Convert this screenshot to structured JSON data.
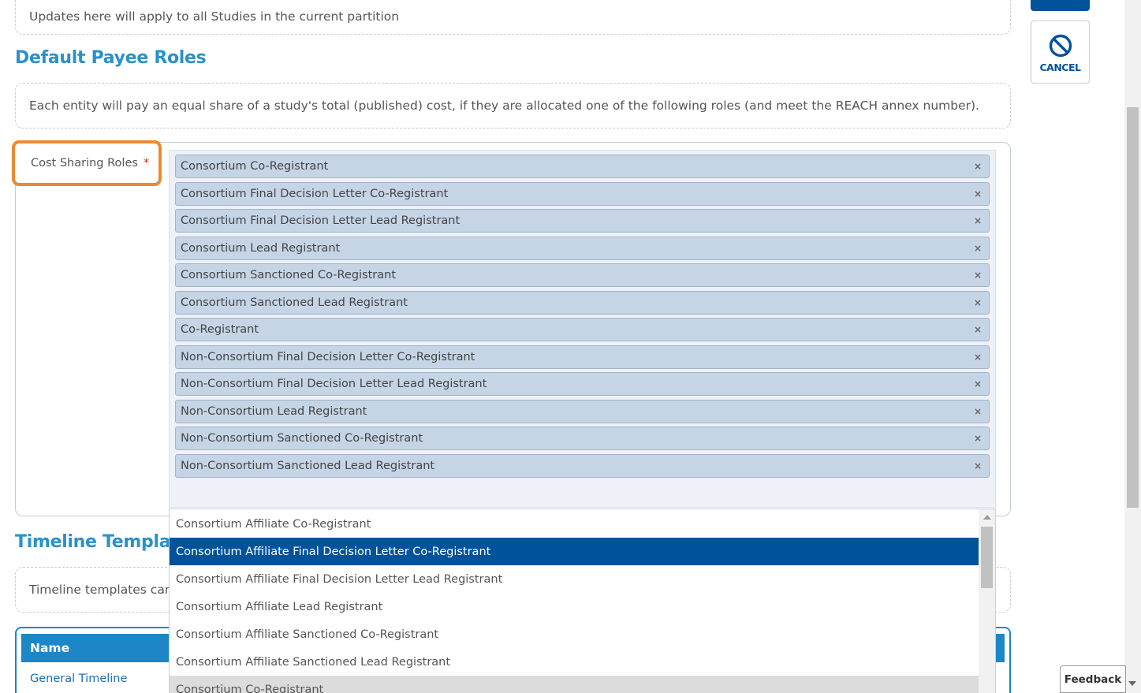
{
  "top_info": {
    "text": "Updates here will apply to all Studies in the current partition"
  },
  "payee": {
    "title": "Default Payee Roles",
    "description": "Each entity will pay an equal share of a study's total (published) cost, if they are allocated one of the following roles (and meet the REACH annex number)."
  },
  "field": {
    "label": "Cost Sharing Roles",
    "required_marker": "*"
  },
  "selected_roles": [
    "Consortium Co-Registrant",
    "Consortium Final Decision Letter Co-Registrant",
    "Consortium Final Decision Letter Lead Registrant",
    "Consortium Lead Registrant",
    "Consortium Sanctioned Co-Registrant",
    "Consortium Sanctioned Lead Registrant",
    "Co-Registrant",
    "Non-Consortium Final Decision Letter Co-Registrant",
    "Non-Consortium Final Decision Letter Lead Registrant",
    "Non-Consortium Lead Registrant",
    "Non-Consortium Sanctioned Co-Registrant",
    "Non-Consortium Sanctioned Lead Registrant"
  ],
  "remove_symbol": "×",
  "dropdown_options": [
    "Consortium Affiliate Co-Registrant",
    "Consortium Affiliate Final Decision Letter Co-Registrant",
    "Consortium Affiliate Final Decision Letter Lead Registrant",
    "Consortium Affiliate Lead Registrant",
    "Consortium Affiliate Sanctioned Co-Registrant",
    "Consortium Affiliate Sanctioned Lead Registrant",
    "Consortium Co-Registrant"
  ],
  "highlighted_option_index": 1,
  "timeline": {
    "title": "Timeline Templates",
    "description": "Timeline templates can",
    "table_header_name": "Name",
    "first_row_name": "General Timeline"
  },
  "actions": {
    "cancel_label": "CANCEL"
  },
  "feedback_label": "Feedback",
  "colors": {
    "accent": "#2a91c9",
    "primary_button": "#00539b",
    "highlight_outline": "#ea8a33",
    "tag_background": "#c5d5e6",
    "table_header": "#1d86c7"
  }
}
